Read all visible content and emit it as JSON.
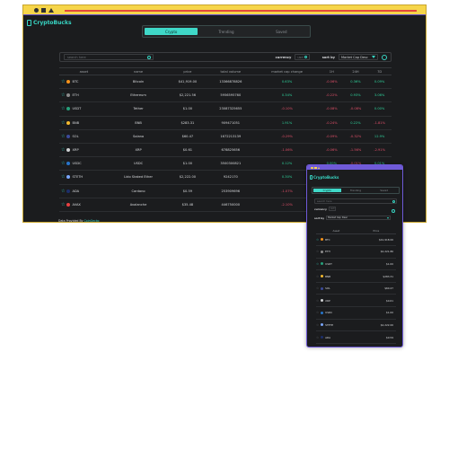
{
  "desktop": {
    "brand": "CryptoBucks",
    "tabs": [
      "Crypto",
      "Trending",
      "Saved"
    ],
    "search_placeholder": "search here",
    "currency_label": "currency",
    "currency_value": "usd",
    "sort_label": "sort by",
    "sort_value": "Market Cap Desc",
    "columns": [
      "asset",
      "name",
      "price",
      "total volume",
      "market cap change",
      "1H",
      "24H",
      "7D"
    ],
    "rows": [
      {
        "symbol": "BTC",
        "name": "Bitcoin",
        "price": "$41,919.00",
        "volume": "13366878826",
        "mcap": "0.63%",
        "h1": "-0.06%",
        "h24": "0.36%",
        "d7": "0.09%",
        "icon_color": "#f7931a"
      },
      {
        "symbol": "ETH",
        "name": "Ethereum",
        "price": "$2,221.56",
        "volume": "5956595760",
        "mcap": "0.34%",
        "h1": "-0.22%",
        "h24": "0.93%",
        "d7": "3.06%",
        "icon_color": "#8c8c8c"
      },
      {
        "symbol": "USDT",
        "name": "Tether",
        "price": "$1.00",
        "volume": "23087325655",
        "mcap": "-0.10%",
        "h1": "-0.08%",
        "h24": "-0.08%",
        "d7": "0.00%",
        "icon_color": "#26a17b"
      },
      {
        "symbol": "BNB",
        "name": "BNB",
        "price": "$283.31",
        "volume": "909471051",
        "mcap": "1.91%",
        "h1": "-0.24%",
        "h24": "0.22%",
        "d7": "-1.81%",
        "icon_color": "#f3ba2f"
      },
      {
        "symbol": "SOL",
        "name": "Solana",
        "price": "$60.47",
        "volume": "1672213139",
        "mcap": "-0.29%",
        "h1": "-0.09%",
        "h24": "-0.32%",
        "d7": "12.9%",
        "icon_color": "#3c4b9a"
      },
      {
        "symbol": "XRP",
        "name": "XRP",
        "price": "$0.61",
        "volume": "678825656",
        "mcap": "-1.06%",
        "h1": "-0.06%",
        "h24": "-1.56%",
        "d7": "-2.91%",
        "icon_color": "#cfd1d3"
      },
      {
        "symbol": "USDC",
        "name": "USDC",
        "price": "$1.00",
        "volume": "3500300821",
        "mcap": "0.12%",
        "h1": "0.00%",
        "h24": "-0.01%",
        "d7": "0.01%",
        "icon_color": "#2775ca"
      },
      {
        "symbol": "STETH",
        "name": "Lido Staked Ether",
        "price": "$2,222.00",
        "volume": "9242170",
        "mcap": "0.30%",
        "h1": "-0.13%",
        "h24": "0.68%",
        "d7": "3.82%",
        "icon_color": "#7aa7ff"
      },
      {
        "symbol": "ADA",
        "name": "Cardano",
        "price": "$0.59",
        "volume": "253909696",
        "mcap": "-1.07%",
        "h1": "-0.21%",
        "h24": "-1.76%",
        "d7": "-4.59%",
        "icon_color": "#1c2f6b"
      },
      {
        "symbol": "AVAX",
        "name": "Avalanche",
        "price": "$35.48",
        "volume": "446750000",
        "mcap": "-2.10%",
        "h1": "-0.48%",
        "h24": "-2.90%",
        "d7": "9.04%",
        "icon_color": "#e84142"
      }
    ],
    "footer_text": "Data Provided By",
    "footer_link": "CoinGecko"
  },
  "mobile": {
    "brand": "CryptoBucks",
    "tabs": [
      "Crypto",
      "Trending",
      "Saved"
    ],
    "search_placeholder": "search here",
    "currency_label": "currency",
    "currency_value": "usd",
    "sort_label": "sort by",
    "sort_value": "Market Cap Desc",
    "columns": [
      "Asset",
      "Price"
    ],
    "rows": [
      {
        "symbol": "BTC",
        "price": "$41,918.00",
        "icon_color": "#f7931a",
        "fav": true
      },
      {
        "symbol": "ETH",
        "price": "$2,221.86",
        "icon_color": "#8c8c8c",
        "fav": false
      },
      {
        "symbol": "USDT",
        "price": "$1.00",
        "icon_color": "#26a17b",
        "fav": true
      },
      {
        "symbol": "BNB",
        "price": "$283.31",
        "icon_color": "#f3ba2f",
        "fav": false
      },
      {
        "symbol": "SOL",
        "price": "$60.47",
        "icon_color": "#3c4b9a",
        "fav": false
      },
      {
        "symbol": "XRP",
        "price": "$0.61",
        "icon_color": "#cfd1d3",
        "fav": false
      },
      {
        "symbol": "USDC",
        "price": "$1.00",
        "icon_color": "#2775ca",
        "fav": false
      },
      {
        "symbol": "STETH",
        "price": "$2,222.00",
        "icon_color": "#7aa7ff",
        "fav": false
      },
      {
        "symbol": "ADA",
        "price": "$0.59",
        "icon_color": "#1c2f6b",
        "fav": false
      }
    ]
  }
}
